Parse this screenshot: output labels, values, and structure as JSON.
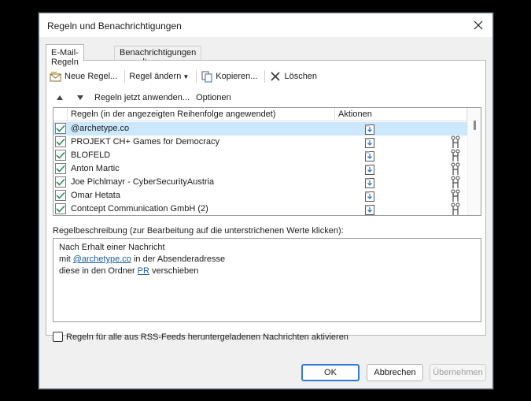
{
  "dialog": {
    "title": "Regeln und Benachrichtigungen"
  },
  "tabs": [
    {
      "label": "E-Mail-Regeln",
      "active": true
    },
    {
      "label": "Benachrichtigungen verwalten",
      "active": false
    }
  ],
  "toolbar": {
    "new_rule": "Neue Regel...",
    "change_rule": "Regel ändern",
    "copy": "Kopieren...",
    "delete": "Löschen"
  },
  "toolbar2": {
    "run_rules": "Regeln jetzt anwenden...",
    "options": "Optionen"
  },
  "rules_list": {
    "columns": [
      "Regeln (in der angezeigten Reihenfolge angewendet)",
      "Aktionen"
    ],
    "rows": [
      {
        "name": "@archetype.co",
        "checked": true,
        "selected": true,
        "has_exception": false
      },
      {
        "name": "PROJEKT CH+ Games for Democracy",
        "checked": true,
        "selected": false,
        "has_exception": true
      },
      {
        "name": "BLOFELD",
        "checked": true,
        "selected": false,
        "has_exception": true
      },
      {
        "name": "Anton Martic",
        "checked": true,
        "selected": false,
        "has_exception": true
      },
      {
        "name": "Joe Pichlmayr - CyberSecurityAustria",
        "checked": true,
        "selected": false,
        "has_exception": true
      },
      {
        "name": "Omar Hetata",
        "checked": true,
        "selected": false,
        "has_exception": true
      },
      {
        "name": "Contcept Communication GmbH (2)",
        "checked": true,
        "selected": false,
        "has_exception": true
      }
    ]
  },
  "description": {
    "label": "Regelbeschreibung (zur Bearbeitung auf die unterstrichenen Werte klicken):",
    "line1": "Nach Erhalt einer Nachricht",
    "line2_pre": "mit ",
    "line2_link": "@archetype.co",
    "line2_post": " in der Absenderadresse",
    "line3_pre": "diese in den Ordner ",
    "line3_link": "PR",
    "line3_post": " verschieben"
  },
  "rss": {
    "label": "Regeln für alle aus RSS-Feeds heruntergeladenen Nachrichten aktivieren",
    "checked": false
  },
  "buttons": {
    "ok": "OK",
    "cancel": "Abbrechen",
    "apply": "Übernehmen"
  },
  "colors": {
    "selection": "#cce8ff",
    "link": "#1a5ea8",
    "check": "#2e8b57",
    "accent": "#2f7dd3"
  }
}
